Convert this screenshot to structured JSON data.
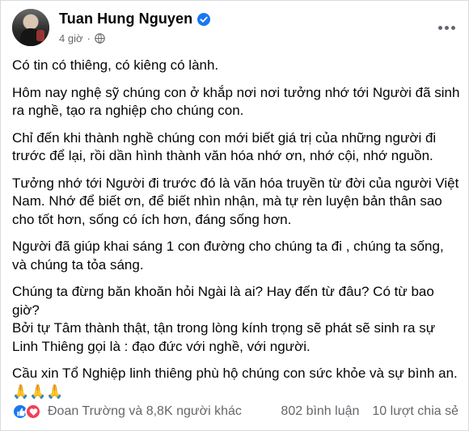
{
  "post": {
    "author": "Tuan Hung Nguyen",
    "time": "4 giờ",
    "dot": "·",
    "paragraphs": [
      "Có tin có thiêng, có kiêng có lành.",
      "Hôm nay nghệ sỹ chúng con ở khắp nơi nơi tưởng nhớ tới Người đã sinh ra nghề, tạo ra nghiệp cho chúng con.",
      "Chỉ đến khi thành nghề chúng con mới biết giá trị của những người đi trước để lại, rồi dần hình thành văn hóa nhớ ơn, nhớ cội, nhớ nguồn.",
      "Tưởng nhớ tới Người đi trước đó là văn hóa truyền từ đời của người Việt Nam. Nhớ để biết ơn, để biết nhìn nhận, mà tự rèn luyện bản thân sao cho tốt hơn, sống có ích hơn, đáng sống hơn.",
      "Người đã giúp khai sáng 1 con đường cho chúng ta đi , chúng ta sống, và chúng ta tỏa sáng.",
      "Chúng ta đừng băn khoăn hỏi Ngài là ai? Hay đến từ đâu? Có từ bao giờ?",
      "Bởi tự  Tâm thành thật, tận trong lòng kính trọng sẽ phát sẽ  sinh ra sự Linh Thiêng  gọi là :  đạo đức với nghề, với người.",
      "Cầu xin Tổ Nghiệp linh thiêng phù hộ chúng con sức khỏe và sự bình an. 🙏🙏🙏"
    ]
  },
  "footer": {
    "reactors": "Đoan Trường và 8,8K người khác",
    "comments": "802 bình luận",
    "shares": "10 lượt chia sẻ"
  },
  "icons": {
    "verified": "verified-badge-icon",
    "audience": "globe-icon",
    "more": "more-options-icon",
    "like": "like-reaction-icon",
    "love": "love-reaction-icon"
  },
  "colors": {
    "verified": "#1877f2",
    "like": "#1877f2",
    "love": "#f33e58",
    "secondary_text": "#65676b"
  }
}
